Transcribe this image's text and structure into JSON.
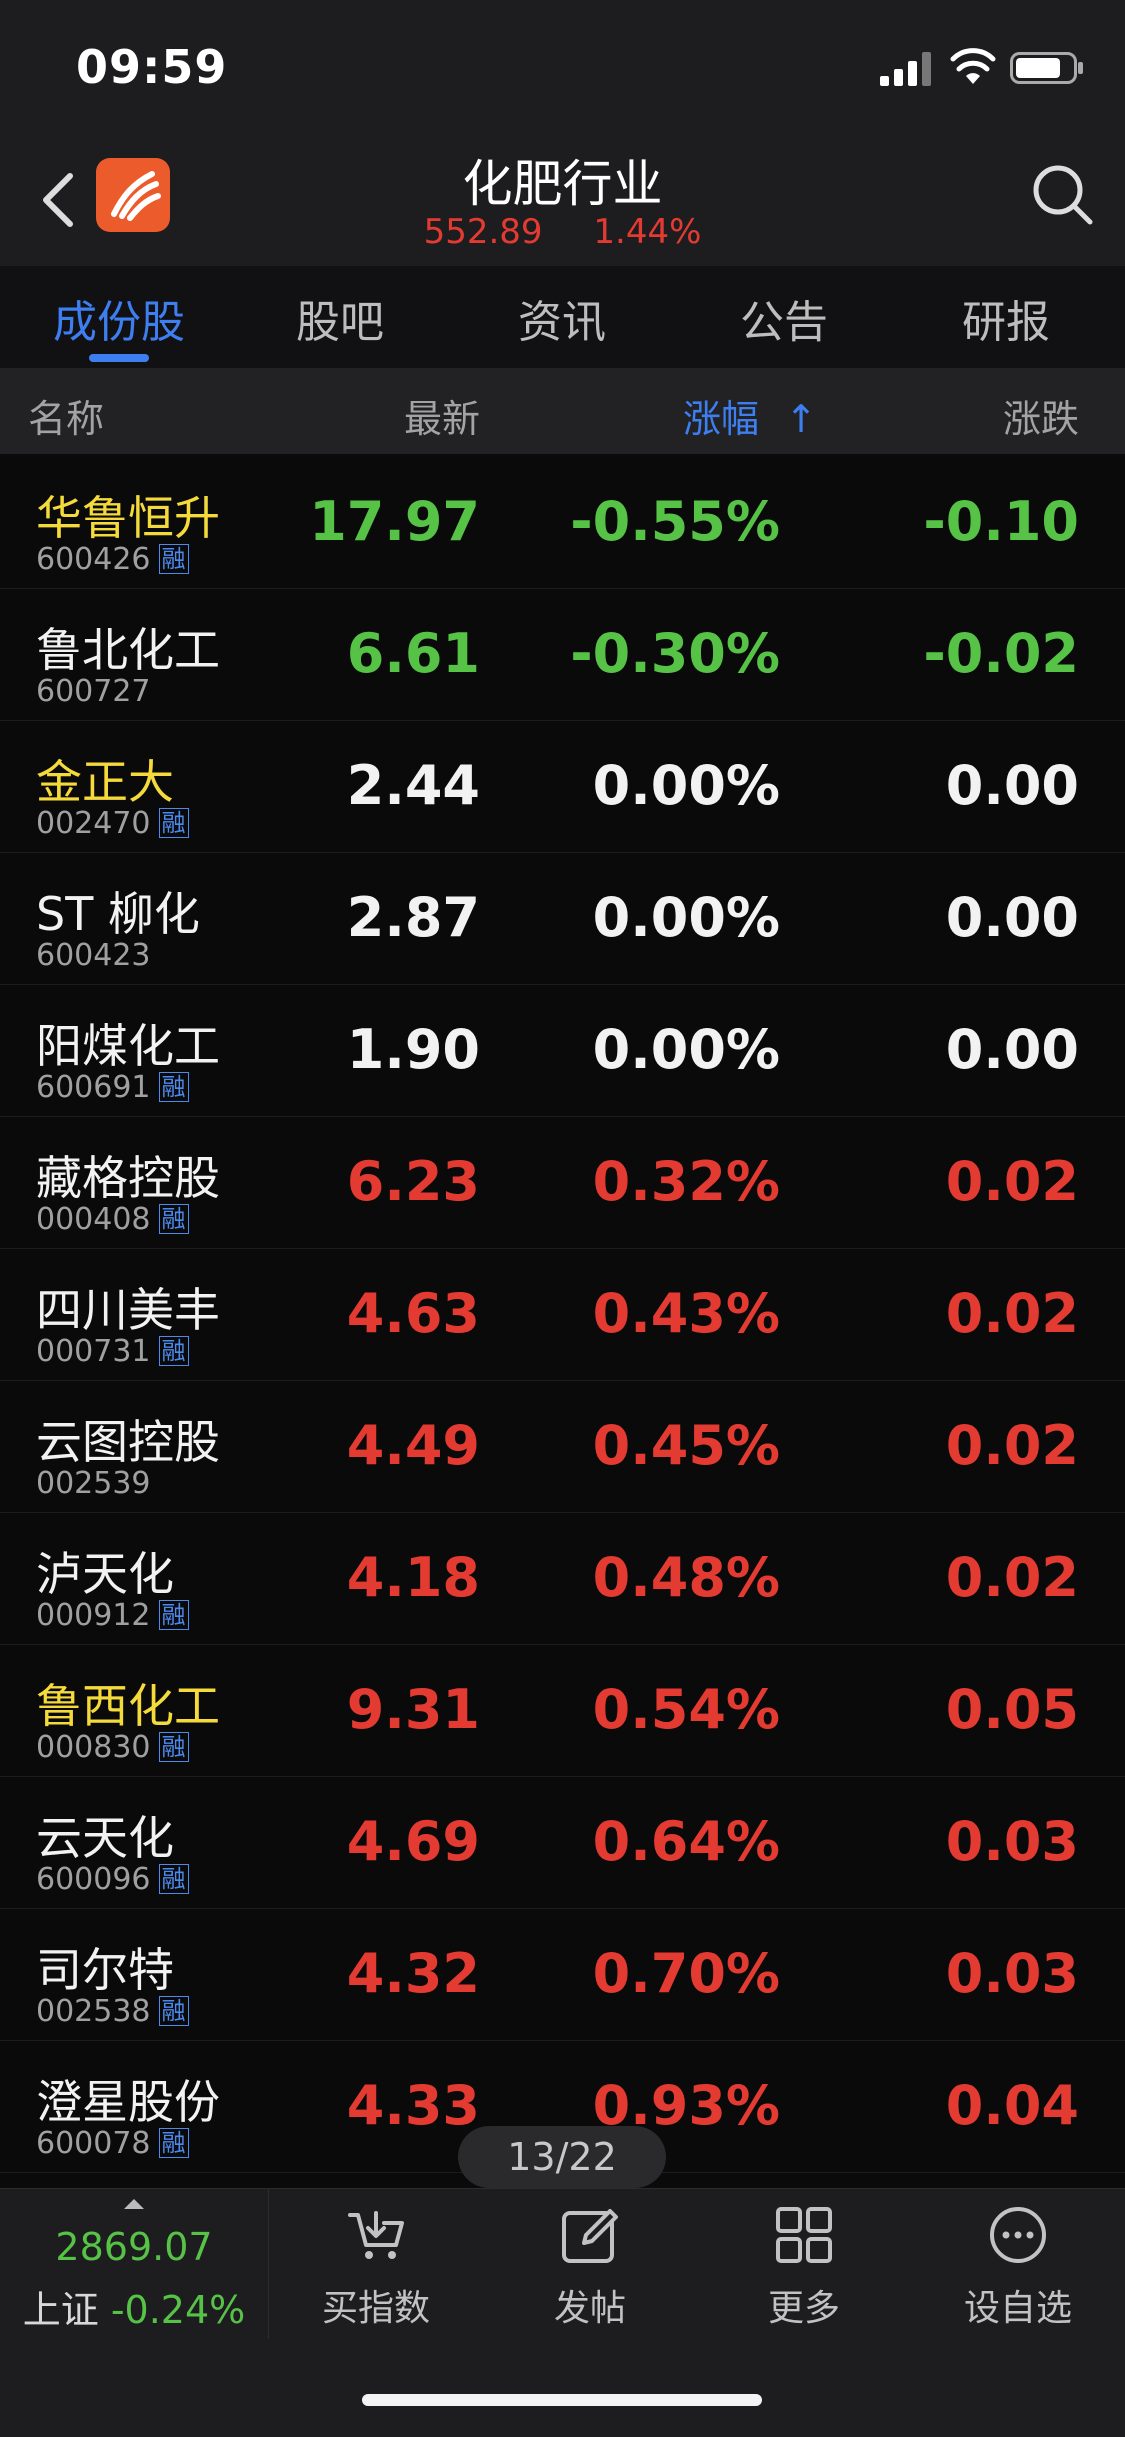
{
  "status": {
    "time": "09:59"
  },
  "header": {
    "title": "化肥行业",
    "price": "552.89",
    "change": "1.44%"
  },
  "tabs": [
    {
      "label": "成份股",
      "active": true
    },
    {
      "label": "股吧",
      "active": false
    },
    {
      "label": "资讯",
      "active": false
    },
    {
      "label": "公告",
      "active": false
    },
    {
      "label": "研报",
      "active": false
    }
  ],
  "columns": {
    "name": "名称",
    "latest": "最新",
    "pct": "涨幅",
    "change": "涨跌",
    "sort_arrow": "↑"
  },
  "rz_label": "融",
  "colors": {
    "up": "#e33b32",
    "down": "#56c347",
    "flat": "#f2f2f2",
    "accent": "#3d7ff0",
    "highlight_name": "#f5da3b"
  },
  "rows": [
    {
      "name": "华鲁恒升",
      "code": "600426",
      "rz": true,
      "latest": "17.97",
      "pct": "-0.55%",
      "change": "-0.10",
      "trend": "green",
      "highlight": true
    },
    {
      "name": "鲁北化工",
      "code": "600727",
      "rz": false,
      "latest": "6.61",
      "pct": "-0.30%",
      "change": "-0.02",
      "trend": "green",
      "highlight": false
    },
    {
      "name": "金正大",
      "code": "002470",
      "rz": true,
      "latest": "2.44",
      "pct": "0.00%",
      "change": "0.00",
      "trend": "white",
      "highlight": true
    },
    {
      "name": "ST 柳化",
      "code": "600423",
      "rz": false,
      "latest": "2.87",
      "pct": "0.00%",
      "change": "0.00",
      "trend": "white",
      "highlight": false
    },
    {
      "name": "阳煤化工",
      "code": "600691",
      "rz": true,
      "latest": "1.90",
      "pct": "0.00%",
      "change": "0.00",
      "trend": "white",
      "highlight": false
    },
    {
      "name": "藏格控股",
      "code": "000408",
      "rz": true,
      "latest": "6.23",
      "pct": "0.32%",
      "change": "0.02",
      "trend": "red",
      "highlight": false
    },
    {
      "name": "四川美丰",
      "code": "000731",
      "rz": true,
      "latest": "4.63",
      "pct": "0.43%",
      "change": "0.02",
      "trend": "red",
      "highlight": false
    },
    {
      "name": "云图控股",
      "code": "002539",
      "rz": false,
      "latest": "4.49",
      "pct": "0.45%",
      "change": "0.02",
      "trend": "red",
      "highlight": false
    },
    {
      "name": "泸天化",
      "code": "000912",
      "rz": true,
      "latest": "4.18",
      "pct": "0.48%",
      "change": "0.02",
      "trend": "red",
      "highlight": false
    },
    {
      "name": "鲁西化工",
      "code": "000830",
      "rz": true,
      "latest": "9.31",
      "pct": "0.54%",
      "change": "0.05",
      "trend": "red",
      "highlight": true
    },
    {
      "name": "云天化",
      "code": "600096",
      "rz": true,
      "latest": "4.69",
      "pct": "0.64%",
      "change": "0.03",
      "trend": "red",
      "highlight": false
    },
    {
      "name": "司尔特",
      "code": "002538",
      "rz": true,
      "latest": "4.32",
      "pct": "0.70%",
      "change": "0.03",
      "trend": "red",
      "highlight": false
    },
    {
      "name": "澄星股份",
      "code": "600078",
      "rz": true,
      "latest": "4.33",
      "pct": "0.93%",
      "change": "0.04",
      "trend": "red",
      "highlight": false
    }
  ],
  "pager": "13/22",
  "bottom": {
    "index_value": "2869.07",
    "index_name": "上证",
    "index_change": "-0.24%",
    "buttons": [
      {
        "label": "买指数",
        "icon": "cart-icon"
      },
      {
        "label": "发帖",
        "icon": "compose-icon"
      },
      {
        "label": "更多",
        "icon": "grid-icon"
      },
      {
        "label": "设自选",
        "icon": "more-dots-icon"
      }
    ]
  }
}
